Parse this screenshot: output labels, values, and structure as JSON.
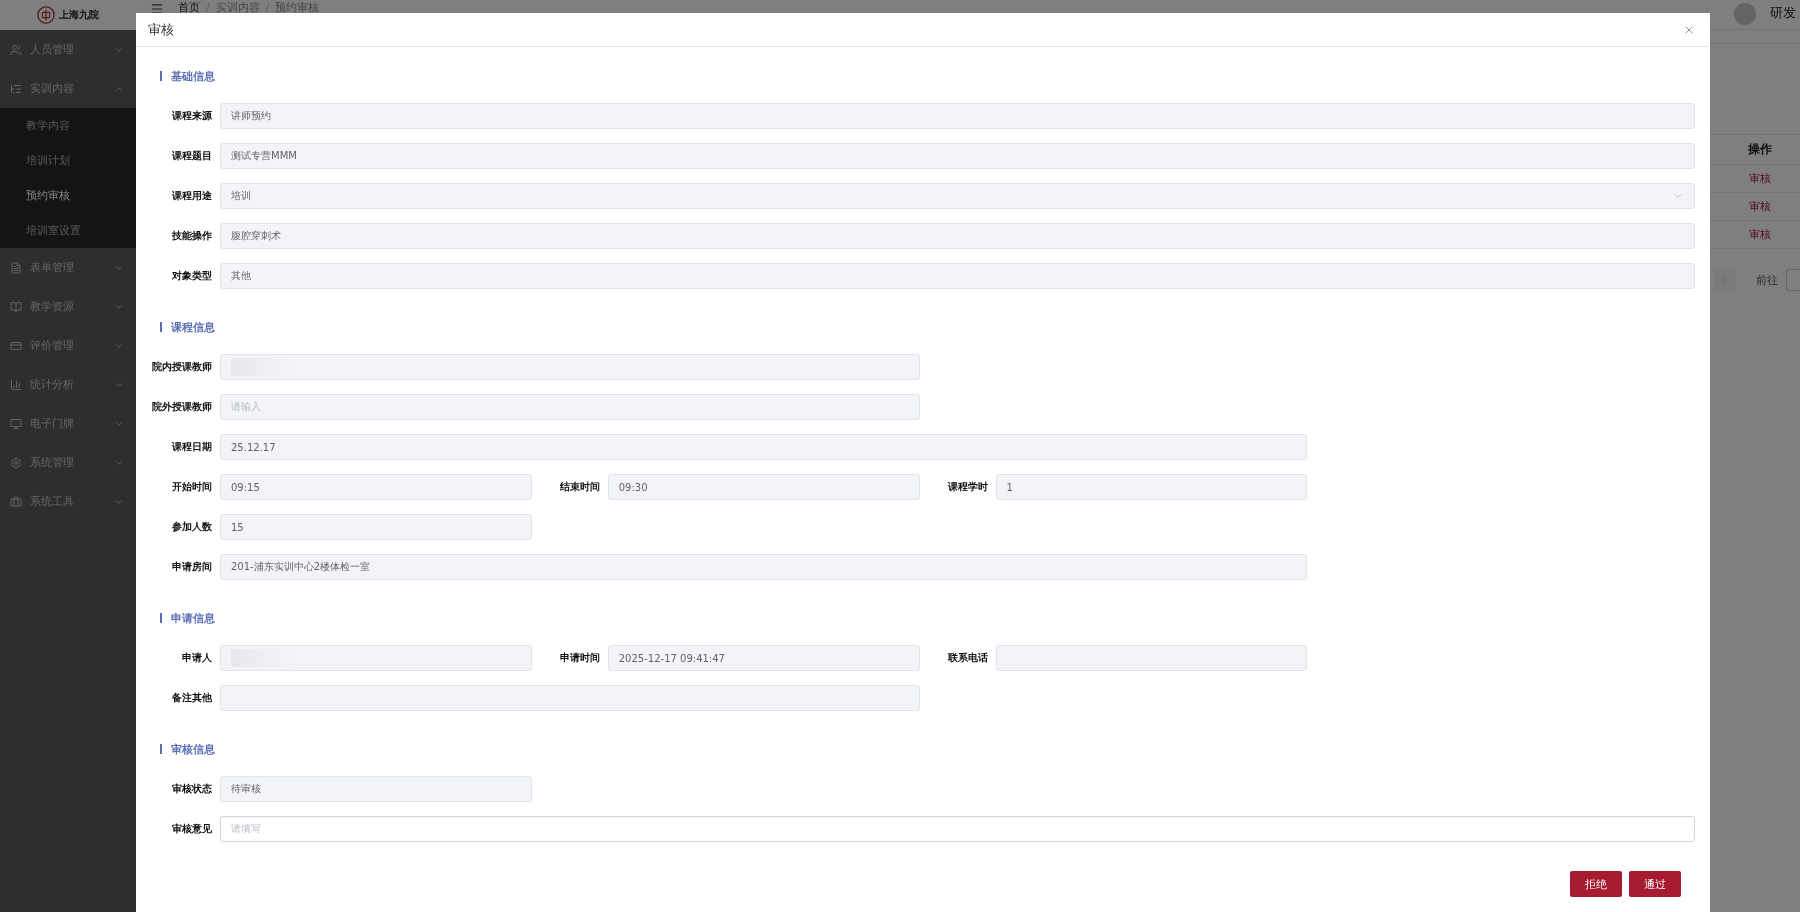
{
  "sidebar": {
    "logo": "上海九院",
    "items": [
      {
        "label": "人员管理",
        "expanded": false
      },
      {
        "label": "实训内容",
        "expanded": true,
        "children": [
          {
            "label": "教学内容",
            "selected": false
          },
          {
            "label": "培训计划",
            "selected": false
          },
          {
            "label": "预约审核",
            "selected": true
          },
          {
            "label": "培训室设置",
            "selected": false
          }
        ]
      },
      {
        "label": "表单管理",
        "expanded": false
      },
      {
        "label": "教学资源",
        "expanded": false
      },
      {
        "label": "评价管理",
        "expanded": false
      },
      {
        "label": "统计分析",
        "expanded": false
      },
      {
        "label": "电子门牌",
        "expanded": false
      },
      {
        "label": "系统管理",
        "expanded": false
      },
      {
        "label": "系统工具",
        "expanded": false
      }
    ]
  },
  "header": {
    "breadcrumbs": [
      "首页",
      "实训内容",
      "预约审核"
    ],
    "separator": "/",
    "user": "研发"
  },
  "table": {
    "columns": [
      "操作"
    ],
    "rows": [
      [
        "审核"
      ],
      [
        "审核"
      ],
      [
        "审核"
      ]
    ]
  },
  "pagination": {
    "goto_label": "前往"
  },
  "dialog": {
    "title": "审核",
    "sections": [
      {
        "title": "基础信息",
        "rows": [
          {
            "fields": [
              {
                "label": "课程来源",
                "kind": "text",
                "value": "讲师预约",
                "disabled": true
              }
            ]
          },
          {
            "fields": [
              {
                "label": "课程题目",
                "kind": "text",
                "value": "测试专营MMM",
                "disabled": true
              }
            ]
          },
          {
            "fields": [
              {
                "label": "课程用途",
                "kind": "select",
                "value": "培训",
                "disabled": true
              }
            ]
          },
          {
            "fields": [
              {
                "label": "技能操作",
                "kind": "text",
                "value": "腹腔穿刺术",
                "disabled": true
              }
            ]
          },
          {
            "fields": [
              {
                "label": "对象类型",
                "kind": "text",
                "value": "其他",
                "disabled": true
              }
            ]
          }
        ]
      },
      {
        "title": "课程信息",
        "rows": [
          {
            "fields": [
              {
                "label": "院内授课教师",
                "kind": "redacted",
                "disabled": true
              }
            ]
          },
          {
            "fields": [
              {
                "label": "院外授课教师",
                "kind": "text",
                "placeholder": "请输入",
                "disabled": true
              }
            ]
          },
          {
            "fields": [
              {
                "label": "课程日期",
                "kind": "text",
                "value": "25.12.17",
                "disabled": true
              }
            ]
          },
          {
            "fields": [
              {
                "label": "开始时间",
                "kind": "text",
                "value": "09:15",
                "disabled": true
              },
              {
                "label": "结束时间",
                "kind": "text",
                "value": "09:30",
                "disabled": true
              },
              {
                "label": "课程学时",
                "kind": "text",
                "value": "1",
                "disabled": true
              }
            ]
          },
          {
            "fields": [
              {
                "label": "参加人数",
                "kind": "text",
                "value": "15",
                "disabled": true
              }
            ]
          },
          {
            "fields": [
              {
                "label": "申请房间",
                "kind": "text",
                "value": "201-浦东实训中心2楼体检一室",
                "disabled": true
              }
            ]
          }
        ]
      },
      {
        "title": "申请信息",
        "rows": [
          {
            "fields": [
              {
                "label": "申请人",
                "kind": "redacted",
                "disabled": true
              },
              {
                "label": "申请时间",
                "kind": "text",
                "value": "2025-12-17 09:41:47",
                "disabled": true
              },
              {
                "label": "联系电话",
                "kind": "text",
                "disabled": true
              }
            ]
          },
          {
            "fields": [
              {
                "label": "备注其他",
                "kind": "text",
                "disabled": true
              }
            ]
          }
        ]
      },
      {
        "title": "审核信息",
        "rows": [
          {
            "fields": [
              {
                "label": "审核状态",
                "kind": "text",
                "value": "待审核",
                "disabled": true
              }
            ]
          },
          {
            "fields": [
              {
                "label": "审核意见",
                "kind": "text",
                "placeholder": "请填写",
                "disabled": false
              }
            ]
          }
        ]
      }
    ],
    "buttons": [
      {
        "label": "拒绝"
      },
      {
        "label": "通过"
      }
    ]
  }
}
